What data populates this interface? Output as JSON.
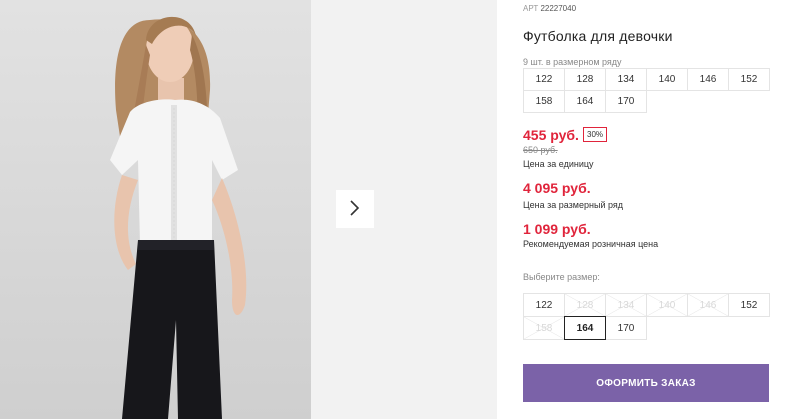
{
  "product": {
    "article_label": "АРТ",
    "article": "22227040",
    "title": "Футболка для девочки",
    "row_note": "9 шт. в размерном ряду"
  },
  "size_row": [
    "122",
    "128",
    "134",
    "140",
    "146",
    "152",
    "158",
    "164",
    "170"
  ],
  "prices": {
    "unit_price": "455 руб.",
    "discount": "30%",
    "old_price": "650 руб.",
    "unit_caption": "Цена за единицу",
    "row_price": "4 095 руб.",
    "row_caption": "Цена за размерный ряд",
    "retail_price": "1 099 руб.",
    "retail_caption": "Рекомендуемая розничная цена"
  },
  "size_select": {
    "label": "Выберите размер:",
    "options": [
      {
        "label": "122",
        "available": true
      },
      {
        "label": "128",
        "available": false
      },
      {
        "label": "134",
        "available": false
      },
      {
        "label": "140",
        "available": false
      },
      {
        "label": "146",
        "available": false
      },
      {
        "label": "152",
        "available": true
      },
      {
        "label": "158",
        "available": false
      },
      {
        "label": "164",
        "available": true,
        "selected": true
      },
      {
        "label": "170",
        "available": true
      }
    ]
  },
  "order_button": "ОФОРМИТЬ ЗАКАЗ",
  "gallery": {
    "next_icon": "chevron-right-icon"
  },
  "colors": {
    "accent_price": "#e0243b",
    "button": "#7b62a8"
  }
}
